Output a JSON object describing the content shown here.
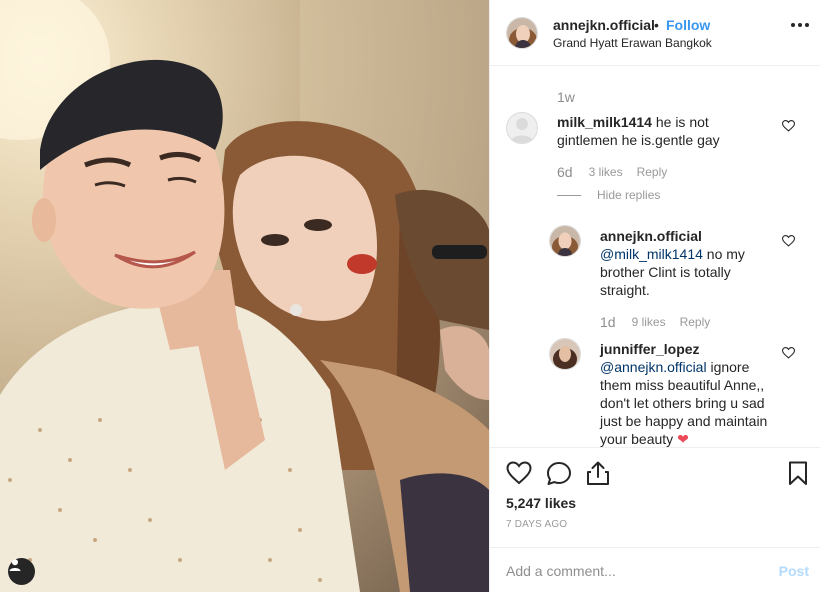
{
  "post": {
    "username": "annejkn.official",
    "separator": "•",
    "follow_label": "Follow",
    "location": "Grand Hyatt Erawan Bangkok"
  },
  "comments": {
    "caption_time": "1w",
    "items": [
      {
        "username": "milk_milk1414",
        "text": "he is not gintlemen he is.gentle gay",
        "time": "6d",
        "likes": "3 likes",
        "reply_label": "Reply"
      }
    ],
    "hide_replies_label": "Hide replies",
    "replies": [
      {
        "username": "annejkn.official",
        "mention": "@milk_milk1414",
        "text": " no my brother Clint is totally straight.",
        "time": "1d",
        "likes": "9 likes",
        "reply_label": "Reply"
      },
      {
        "username": "junniffer_lopez",
        "mention": "@annejkn.official",
        "text": " ignore them miss beautiful Anne,, don't let others bring u sad just be happy and maintain your beauty ",
        "emoji": "❤"
      }
    ]
  },
  "stats": {
    "likes": "5,247 likes",
    "date": "7 DAYS AGO"
  },
  "composer": {
    "placeholder": "Add a comment...",
    "post_label": "Post"
  },
  "icons": {
    "like": "heart-icon",
    "comment": "comment-bubble-icon",
    "share": "share-icon",
    "save": "bookmark-icon",
    "more": "more-options-icon",
    "user_tags": "user-tag-icon",
    "comment_like": "small-heart-icon"
  },
  "colors": {
    "accent": "#3897f0",
    "mention": "#003569",
    "muted": "#8e8e8e",
    "heart_emoji": "#ed4956",
    "post_disabled": "#b3dbff"
  }
}
